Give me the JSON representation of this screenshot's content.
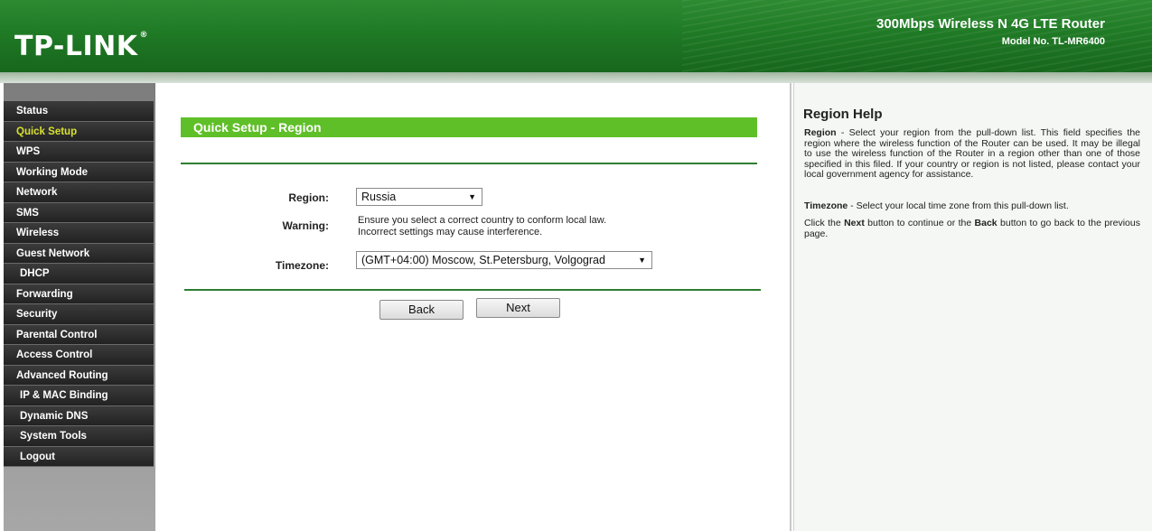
{
  "header": {
    "logo": "TP-LINK",
    "logo_mark": "®",
    "product_name": "300Mbps Wireless N 4G LTE Router",
    "model": "Model No. TL-MR6400"
  },
  "sidebar": {
    "items": [
      {
        "label": "Status"
      },
      {
        "label": "Quick Setup"
      },
      {
        "label": "WPS"
      },
      {
        "label": "Working Mode"
      },
      {
        "label": "Network"
      },
      {
        "label": "SMS"
      },
      {
        "label": "Wireless"
      },
      {
        "label": "Guest Network"
      },
      {
        "label": "DHCP"
      },
      {
        "label": "Forwarding"
      },
      {
        "label": "Security"
      },
      {
        "label": "Parental Control"
      },
      {
        "label": "Access Control"
      },
      {
        "label": "Advanced Routing"
      },
      {
        "label": "IP & MAC Binding"
      },
      {
        "label": "Dynamic DNS"
      },
      {
        "label": "System Tools"
      },
      {
        "label": "Logout"
      }
    ],
    "active_color": "#d8e030"
  },
  "main": {
    "title": "Quick Setup - Region",
    "region_label": "Region:",
    "region_value": "Russia",
    "warning_label": "Warning:",
    "warning_line1": "Ensure you select a correct country to conform local law.",
    "warning_line2": "Incorrect settings may cause interference.",
    "timezone_label": "Timezone:",
    "timezone_value": "(GMT+04:00) Moscow, St.Petersburg, Volgograd",
    "back_label": "Back",
    "next_label": "Next"
  },
  "help": {
    "title": "Region Help",
    "p1_term": "Region",
    "p1_text": " - Select your region from the pull-down list. This field specifies the region where the wireless function of the Router can be used. It may be illegal to use the wireless function of the Router in a region other than one of those specified in this filed. If your country or region is not listed, please contact your local government agency for assistance.",
    "p2_term": "Timezone",
    "p2_text": " - Select your local time zone from this pull-down list.",
    "p3_pre": "Click the ",
    "p3_next": "Next",
    "p3_mid": " button to continue or the ",
    "p3_back": "Back",
    "p3_post": " button to go back to the previous page."
  },
  "colors": {
    "header_green": "#1f7a25",
    "title_bar_green": "#5fbf28",
    "separator_green": "#2e7d32"
  }
}
